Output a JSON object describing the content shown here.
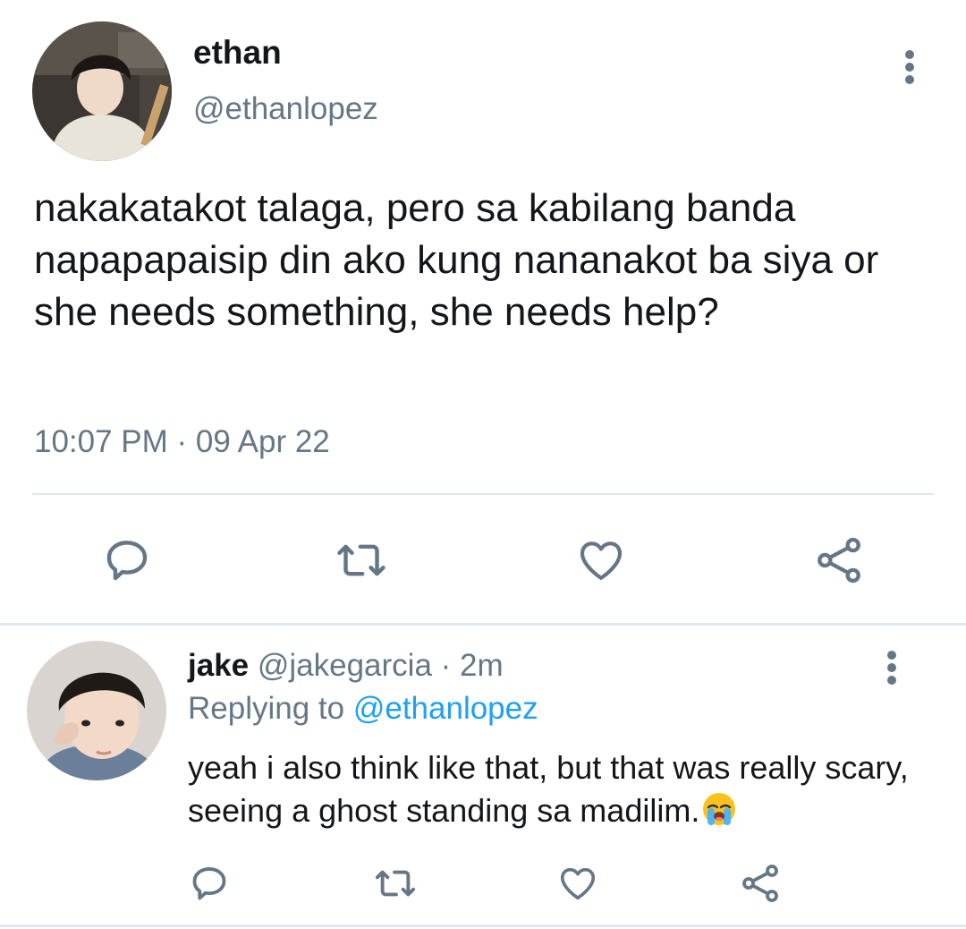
{
  "tweet": {
    "author_name": "ethan",
    "author_handle": "@ethanlopez",
    "text": "nakakatakot talaga, pero sa kabilang banda napapapaisip din ako kung nananakot ba siya or she needs something, she needs help?",
    "timestamp": "10:07 PM · 09 Apr 22"
  },
  "reply": {
    "author_name": "jake",
    "author_handle": "@jakegarcia",
    "separator": " · ",
    "age": "2m",
    "replying_prefix": "Replying to ",
    "replying_to": "@ethanlopez",
    "text": "yeah i also think like that, but that was really scary, seeing a ghost standing sa madilim.",
    "emoji": "loudly-crying-face"
  },
  "icons": {
    "reply": "reply-icon",
    "retweet": "retweet-icon",
    "like": "heart-icon",
    "share": "share-icon",
    "more": "more-vertical-icon"
  },
  "colors": {
    "text": "#14171a",
    "secondary": "#657786",
    "link": "#1da1f2",
    "divider": "#e1e8ed"
  }
}
